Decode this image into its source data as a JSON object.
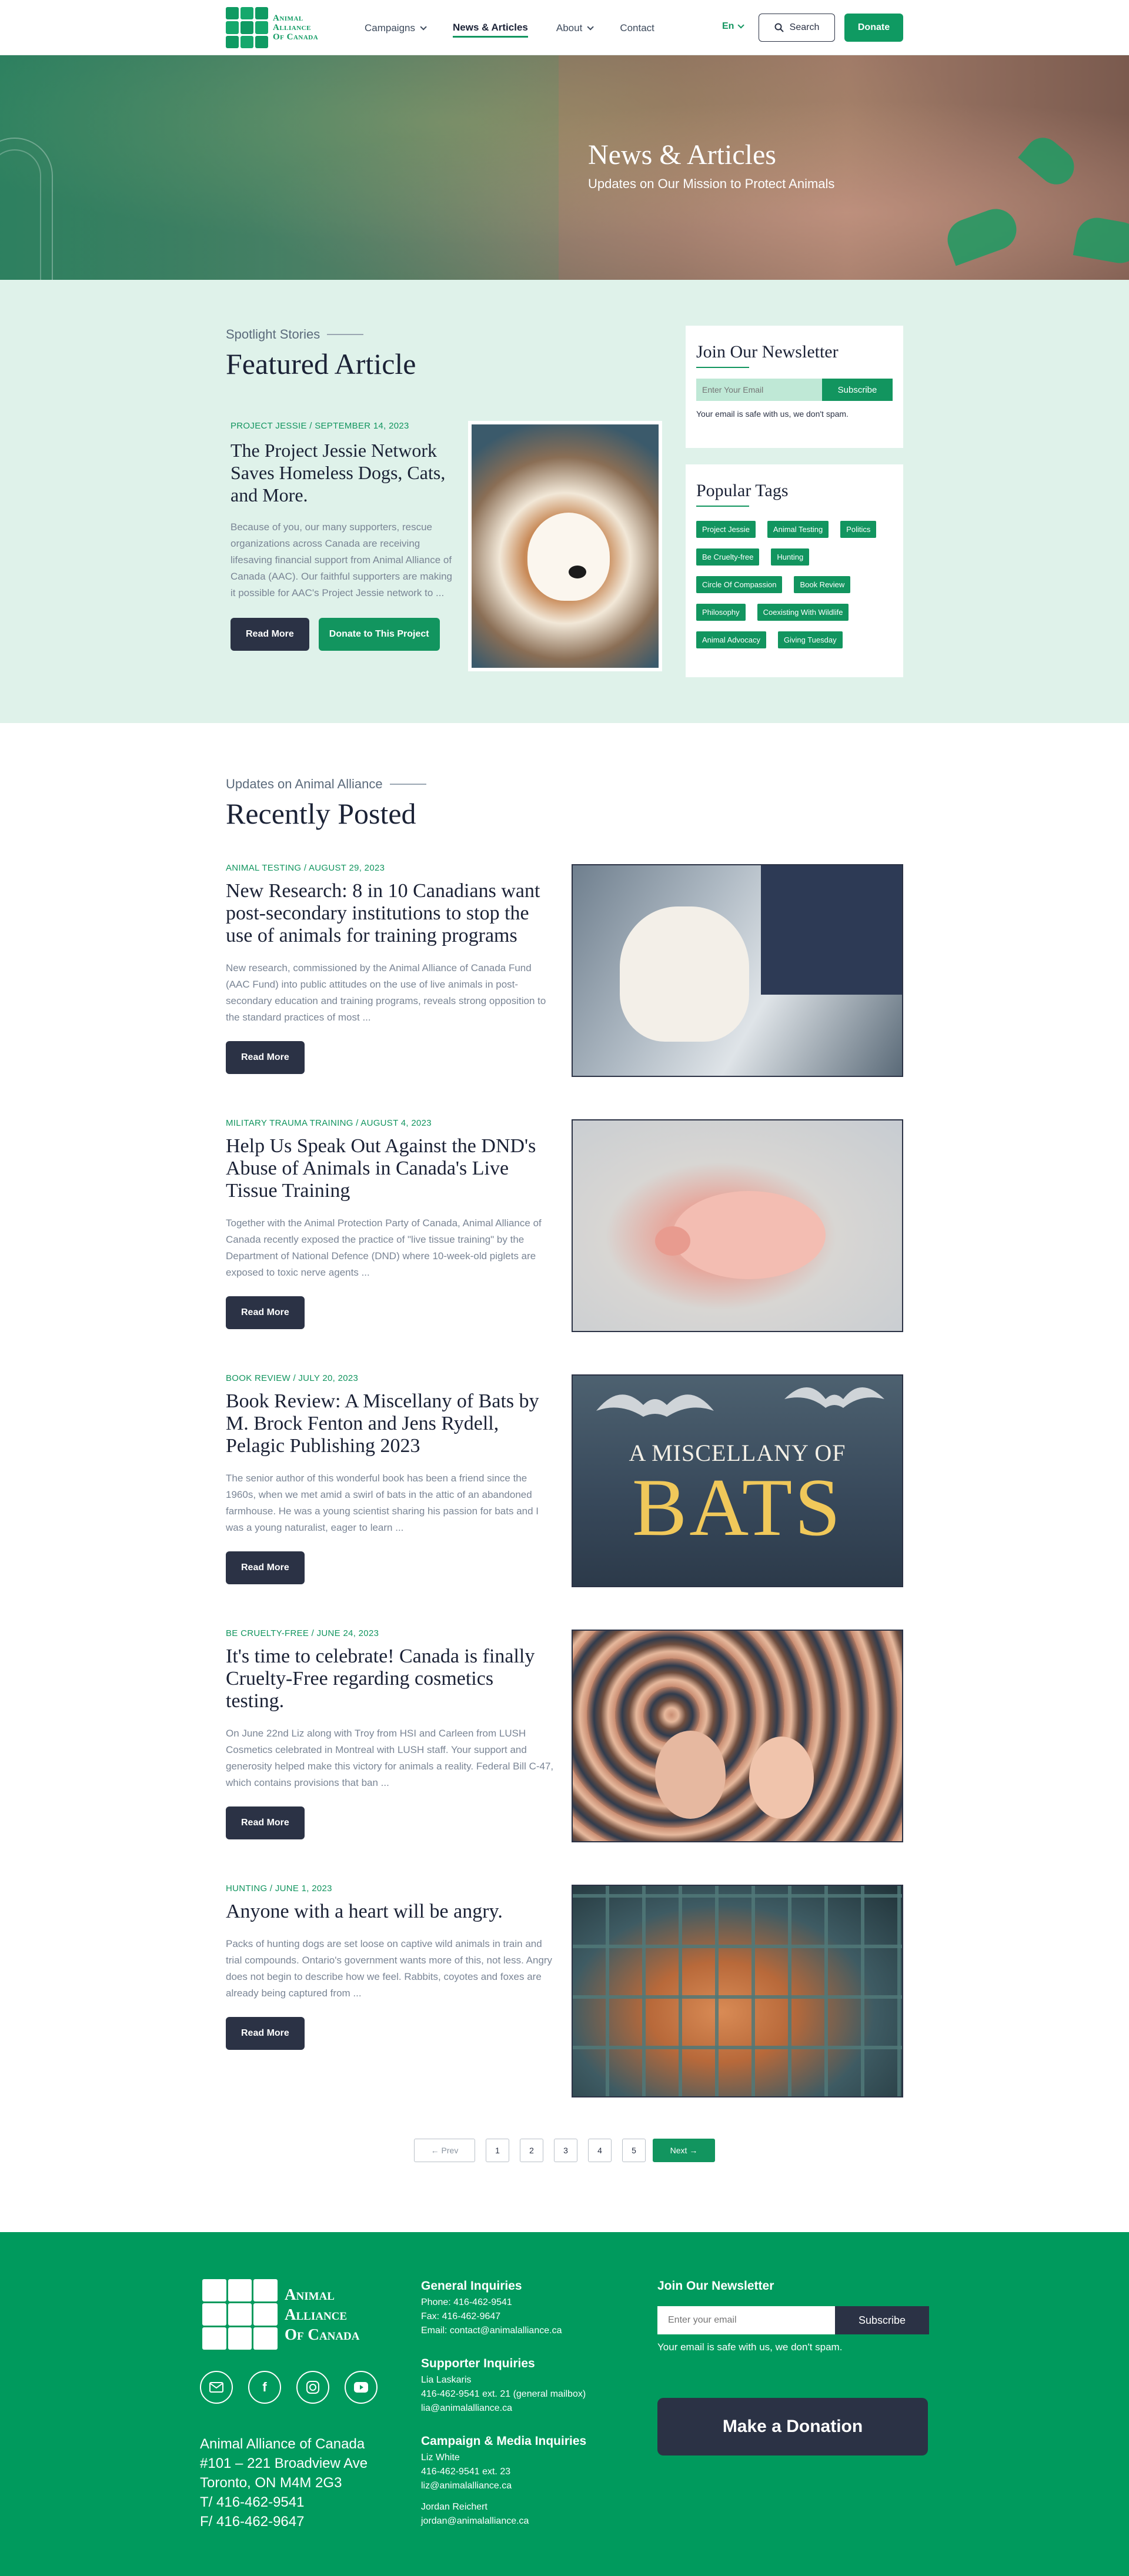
{
  "header": {
    "logo_text": [
      "Animal",
      "Alliance",
      "Of Canada"
    ],
    "nav": [
      {
        "label": "Campaigns",
        "has_dropdown": true
      },
      {
        "label": "News & Articles",
        "active": true
      },
      {
        "label": "About",
        "has_dropdown": true
      },
      {
        "label": "Contact"
      }
    ],
    "language": "En",
    "search_label": "Search",
    "donate_label": "Donate"
  },
  "hero": {
    "title": "News & Articles",
    "subtitle": "Updates on Our Mission to Protect Animals"
  },
  "featured": {
    "eyebrow": "Spotlight Stories",
    "heading": "Featured Article",
    "meta": "PROJECT JESSIE / SEPTEMBER 14, 2023",
    "title": "The Project Jessie Network Saves Homeless Dogs, Cats, and More.",
    "excerpt": "Because of you, our many supporters, rescue organizations across Canada are receiving lifesaving financial support from Animal Alliance of Canada (AAC). Our faithful supporters are making it possible for AAC's Project Jessie network to ...",
    "read_more": "Read More",
    "donate_project": "Donate to This Project"
  },
  "newsletter_widget": {
    "title": "Join Our Newsletter",
    "placeholder": "Enter Your Email",
    "button": "Subscribe",
    "note": "Your email is safe with us, we don't spam."
  },
  "tags_widget": {
    "title": "Popular Tags",
    "tags": [
      "Project Jessie",
      "Animal Testing",
      "Politics",
      "Be Cruelty-free",
      "Hunting",
      "Circle Of Compassion",
      "Book Review",
      "Philosophy",
      "Coexisting With Wildlife",
      "Animal Advocacy",
      "Giving Tuesday"
    ]
  },
  "recent": {
    "eyebrow": "Updates on Animal Alliance",
    "heading": "Recently Posted",
    "read_more": "Read More",
    "posts": [
      {
        "meta": "ANIMAL TESTING / AUGUST 29, 2023",
        "title": "New Research: 8 in 10 Canadians want post-secondary institutions to stop the use of animals for training programs",
        "excerpt": "New research, commissioned by the Animal Alliance of Canada Fund (AAC Fund) into public attitudes on the use of live animals in post-secondary education and training programs, reveals strong opposition to the standard practices of most ..."
      },
      {
        "meta": "MILITARY TRAUMA TRAINING / AUGUST 4, 2023",
        "title": "Help Us Speak Out Against the DND's Abuse of Animals in Canada's Live Tissue Training",
        "excerpt": "Together with the Animal Protection Party of Canada, Animal Alliance of Canada recently exposed the practice of \"live tissue training\" by the Department of National Defence (DND) where 10-week-old piglets are exposed to toxic nerve agents ..."
      },
      {
        "meta": "BOOK REVIEW / JULY 20, 2023",
        "title": "Book Review: A Miscellany of Bats by M. Brock Fenton and Jens Rydell, Pelagic Publishing 2023",
        "excerpt": "The senior author of this wonderful book has been a friend since the 1960s, when we met amid a swirl of bats in the attic of an abandoned farmhouse. He was a young scientist sharing his passion for bats and I was a young naturalist, eager to learn ...",
        "image_text": [
          "A MISCELLANY OF",
          "BATS"
        ]
      },
      {
        "meta": "BE CRUELTY-FREE / JUNE 24, 2023",
        "title": "It's time to celebrate! Canada is finally Cruelty-Free regarding cosmetics testing.",
        "excerpt": "On June 22nd Liz along with Troy from HSI and Carleen from LUSH Cosmetics celebrated in Montreal with LUSH staff. Your support and generosity helped make this victory for animals a reality. Federal Bill C-47, which contains provisions that ban ..."
      },
      {
        "meta": "HUNTING / JUNE 1, 2023",
        "title": "Anyone with a heart will be angry.",
        "excerpt": "Packs of hunting dogs are set loose on captive wild animals in train and trial compounds. Ontario's government wants more of this, not less. Angry does not begin to describe how we feel. Rabbits, coyotes and foxes are already being captured from ..."
      }
    ]
  },
  "pagination": {
    "prev": "← Prev",
    "pages": [
      "1",
      "2",
      "3",
      "4",
      "5"
    ],
    "next": "Next →"
  },
  "footer": {
    "logo_text": [
      "Animal",
      "Alliance",
      "Of Canada"
    ],
    "address": [
      "Animal Alliance of Canada",
      "#101 – 221 Broadview Ave",
      "Toronto, ON M4M 2G3",
      "T/  416-462-9541",
      "F/  416-462-9647"
    ],
    "general": {
      "title": "General Inquiries",
      "lines": [
        "Phone: 416-462-9541",
        "Fax: 416-462-9647",
        "Email: contact@animalalliance.ca"
      ]
    },
    "supporter": {
      "title": "Supporter Inquiries",
      "lines": [
        "Lia Laskaris",
        "416-462-9541 ext. 21 (general mailbox)",
        "lia@animalalliance.ca"
      ]
    },
    "campaign": {
      "title": "Campaign & Media Inquiries",
      "lines": [
        "Liz White",
        "416-462-9541 ext. 23",
        "liz@animalalliance.ca",
        "",
        "Jordan Reichert",
        "jordan@animalalliance.ca"
      ]
    },
    "newsletter": {
      "title": "Join Our Newsletter",
      "placeholder": "Enter your email",
      "button": "Subscribe",
      "note": "Your email is safe with us, we don't spam."
    },
    "donation_label": "Make a Donation"
  },
  "colors": {
    "brand_green": "#0f9a62",
    "dark": "#2b3245",
    "mint": "#dff2ea"
  }
}
